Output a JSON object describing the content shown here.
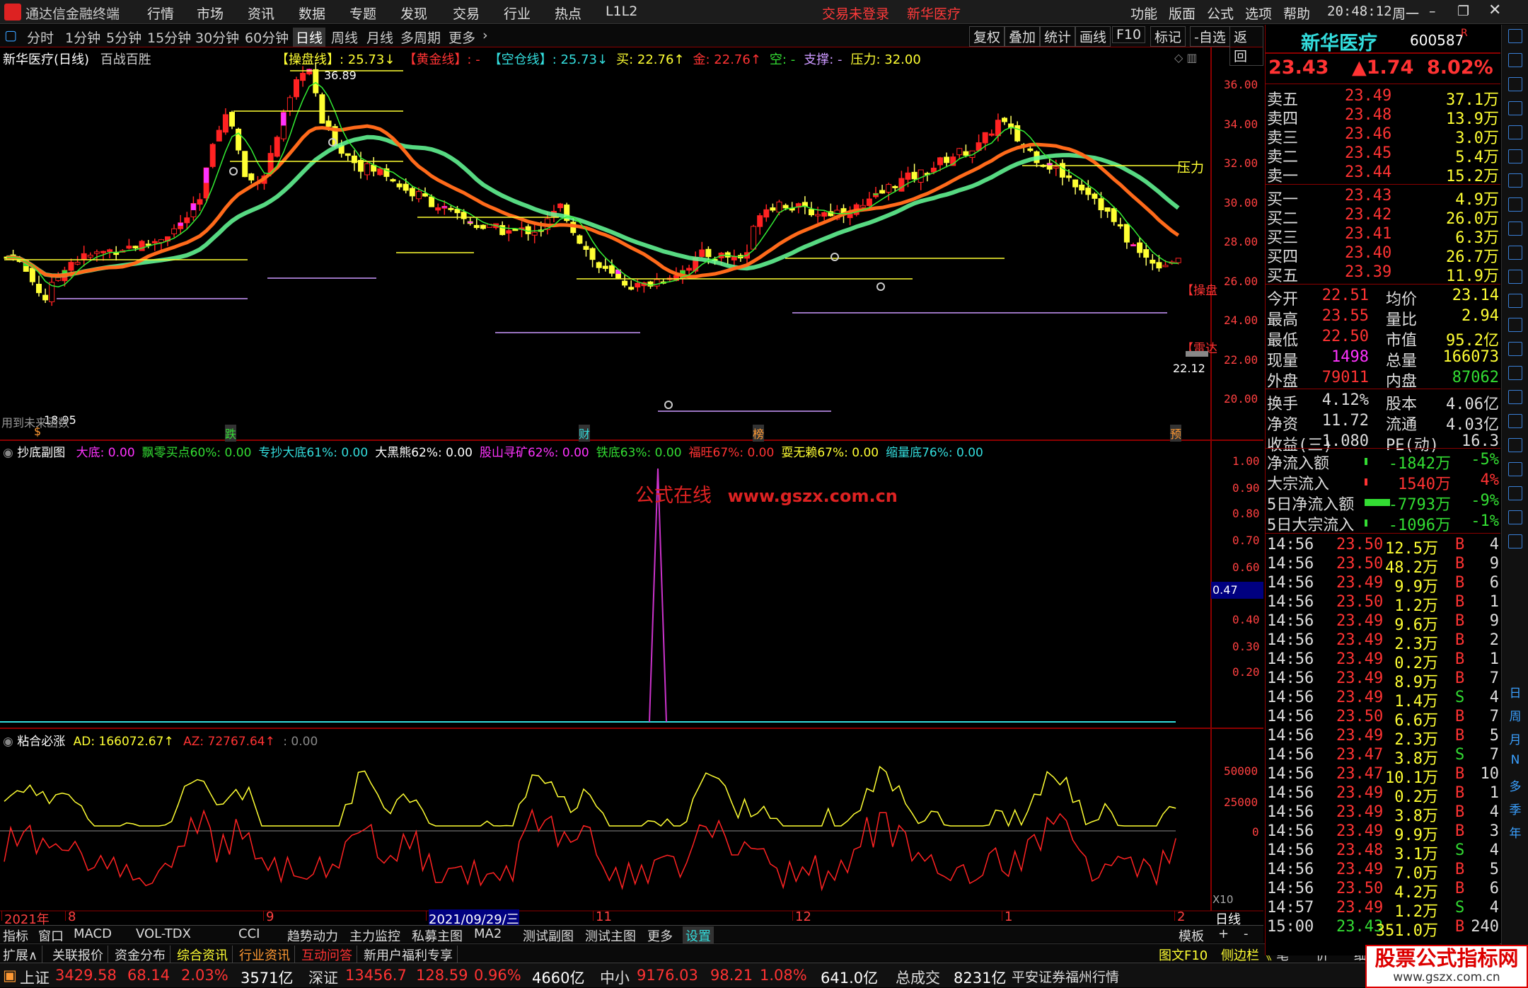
{
  "titlebar": {
    "app": "通达信金融终端",
    "menu": [
      "行情",
      "市场",
      "资讯",
      "数据",
      "专题",
      "发现",
      "交易",
      "行业",
      "热点",
      "L1L2"
    ],
    "login": "交易未登录",
    "stock": "新华医疗",
    "right": [
      "功能",
      "版面",
      "公式",
      "选项",
      "帮助"
    ],
    "time": "20:48:12",
    "weekday": "周一"
  },
  "toolbar": {
    "periods": [
      "分时",
      "1分钟",
      "5分钟",
      "15分钟",
      "30分钟",
      "60分钟",
      "日线",
      "周线",
      "月线",
      "多周期",
      "更多"
    ],
    "active": "日线",
    "buttons": [
      "复权",
      "叠加",
      "统计",
      "画线",
      "F10",
      "标记",
      "-自选",
      "返回"
    ]
  },
  "main_chart": {
    "title": "新华医疗(日线)",
    "subtitle": "百战百胜",
    "indicators": [
      {
        "label": "【操盘线】",
        "value": ": 25.73↓",
        "color": "#ffff33"
      },
      {
        "label": "【黄金线】",
        "value": ": -",
        "color": "#ff3333"
      },
      {
        "label": "【空仓线】",
        "value": ": 25.73↓",
        "color": "#33dddd"
      },
      {
        "label": "买",
        "value": ": 22.76↑",
        "color": "#ffff33"
      },
      {
        "label": "金",
        "value": ": 22.76↑",
        "color": "#ff3333"
      },
      {
        "label": "空",
        "value": ": -",
        "color": "#33dd33"
      },
      {
        "label": "支撑",
        "value": ": -",
        "color": "#cc99ff"
      },
      {
        "label": "压力",
        "value": ": 32.00",
        "color": "#ffff33"
      }
    ],
    "yaxis": [
      "36.00",
      "34.00",
      "32.00",
      "30.00",
      "28.00",
      "26.00",
      "24.00",
      "22.00",
      "20.00"
    ],
    "annotations": {
      "high": "36.89",
      "low": "18.95",
      "last": "22.12",
      "pressure": "压力",
      "op": "【操盘",
      "lei": "【雷达",
      "mid": "用到未来函数"
    },
    "bottom_marks": [
      "$",
      "跌",
      "财",
      "榜",
      "预"
    ]
  },
  "sub1": {
    "title": "抄底副图",
    "items": [
      {
        "t": "大底: 0.00",
        "c": "#ff33ff"
      },
      {
        "t": "飘零买点60%: 0.00",
        "c": "#33dd33"
      },
      {
        "t": "专抄大底61%: 0.00",
        "c": "#33dddd"
      },
      {
        "t": "大黑熊62%: 0.00",
        "c": "#ffffff"
      },
      {
        "t": "股山寻矿62%: 0.00",
        "c": "#ff33ff"
      },
      {
        "t": "铁底63%: 0.00",
        "c": "#33dd33"
      },
      {
        "t": "福旺67%: 0.00",
        "c": "#ff3333"
      },
      {
        "t": "耍无赖67%: 0.00",
        "c": "#ffff33"
      },
      {
        "t": "缩量底76%: 0.00",
        "c": "#33dddd"
      }
    ],
    "watermark": "公式在线",
    "watermark_url": "www.gszx.com.cn",
    "yaxis": [
      "1.00",
      "0.90",
      "0.80",
      "0.70",
      "0.60",
      "0.40",
      "0.30",
      "0.20"
    ],
    "current": "0.47"
  },
  "sub2": {
    "title": "粘合必涨",
    "ad": "AD: 166072.67↑",
    "az": "AZ: 72767.64↑",
    "extra": ": 0.00",
    "yaxis": [
      "50000",
      "25000",
      "0"
    ],
    "x10": "X10"
  },
  "dates": {
    "labels": [
      "2021年",
      "8",
      "9",
      "2021/09/29/三",
      "11",
      "12",
      "1",
      "2"
    ],
    "right": "日线"
  },
  "bottomtabs": [
    "指标",
    "窗口",
    "MACD",
    "VOL-TDX",
    "CCI",
    "趋势动力",
    "主力监控",
    "私募主图",
    "MA2",
    "测试副图",
    "测试主图",
    "更多",
    "设置"
  ],
  "bottomtabs_right": [
    "模板",
    "+",
    "-"
  ],
  "bar2": [
    "扩展∧",
    "关联报价",
    "资金分布",
    "综合资讯",
    "行业资讯",
    "互动问答",
    "新用户福利专享"
  ],
  "bar2_right": [
    "图文F10",
    "侧边栏《",
    "笔",
    "价",
    "细",
    "势",
    "联",
    "值",
    "主"
  ],
  "quote": {
    "name": "新华医疗",
    "code": "600587",
    "r": "R",
    "price": "23.43",
    "change": "▲1.74",
    "pct": "8.02%",
    "asks": [
      [
        "卖五",
        "23.49",
        "37.1万"
      ],
      [
        "卖四",
        "23.48",
        "13.9万"
      ],
      [
        "卖三",
        "23.46",
        "3.0万"
      ],
      [
        "卖二",
        "23.45",
        "5.4万"
      ],
      [
        "卖一",
        "23.44",
        "15.2万"
      ]
    ],
    "bids": [
      [
        "买一",
        "23.43",
        "4.9万"
      ],
      [
        "买二",
        "23.42",
        "26.0万"
      ],
      [
        "买三",
        "23.41",
        "6.3万"
      ],
      [
        "买四",
        "23.40",
        "26.7万"
      ],
      [
        "买五",
        "23.39",
        "11.9万"
      ]
    ],
    "stats": [
      [
        "今开",
        "22.51",
        "均价",
        "23.14"
      ],
      [
        "最高",
        "23.55",
        "量比",
        "2.94"
      ],
      [
        "最低",
        "22.50",
        "市值",
        "95.2亿"
      ],
      [
        "现量",
        "1498",
        "总量",
        "166073"
      ],
      [
        "外盘",
        "79011",
        "内盘",
        "87062"
      ]
    ],
    "stats2": [
      [
        "换手",
        "4.12%",
        "股本",
        "4.06亿"
      ],
      [
        "净资",
        "11.72",
        "流通",
        "4.03亿"
      ],
      [
        "收益(三)",
        "1.080",
        "PE(动)",
        "16.3"
      ]
    ],
    "flows": [
      [
        "净流入额",
        "-1842万",
        "-5%"
      ],
      [
        "大宗流入",
        "1540万",
        "4%"
      ],
      [
        "5日净流入额",
        "-7793万",
        "-9%"
      ],
      [
        "5日大宗流入",
        "-1096万",
        "-1%"
      ]
    ],
    "ticks": [
      [
        "14:56",
        "23.50",
        "12.5万",
        "B",
        "4"
      ],
      [
        "14:56",
        "23.50",
        "48.2万",
        "B",
        "9"
      ],
      [
        "14:56",
        "23.49",
        "9.9万",
        "B",
        "6"
      ],
      [
        "14:56",
        "23.50",
        "1.2万",
        "B",
        "1"
      ],
      [
        "14:56",
        "23.49",
        "9.6万",
        "B",
        "9"
      ],
      [
        "14:56",
        "23.49",
        "2.3万",
        "B",
        "2"
      ],
      [
        "14:56",
        "23.49",
        "0.2万",
        "B",
        "1"
      ],
      [
        "14:56",
        "23.49",
        "8.9万",
        "B",
        "7"
      ],
      [
        "14:56",
        "23.49",
        "1.4万",
        "S",
        "4"
      ],
      [
        "14:56",
        "23.50",
        "6.6万",
        "B",
        "7"
      ],
      [
        "14:56",
        "23.49",
        "2.3万",
        "B",
        "5"
      ],
      [
        "14:56",
        "23.47",
        "3.8万",
        "S",
        "7"
      ],
      [
        "14:56",
        "23.47",
        "10.1万",
        "B",
        "10"
      ],
      [
        "14:56",
        "23.49",
        "0.2万",
        "B",
        "1"
      ],
      [
        "14:56",
        "23.49",
        "3.8万",
        "B",
        "4"
      ],
      [
        "14:56",
        "23.49",
        "9.9万",
        "B",
        "3"
      ],
      [
        "14:56",
        "23.48",
        "3.1万",
        "S",
        "4"
      ],
      [
        "14:56",
        "23.49",
        "7.0万",
        "B",
        "5"
      ],
      [
        "14:56",
        "23.50",
        "4.2万",
        "B",
        "6"
      ],
      [
        "14:57",
        "23.49",
        "1.2万",
        "S",
        "4"
      ],
      [
        "15:00",
        "23.43",
        "351.0万",
        "B",
        "240"
      ]
    ]
  },
  "sidebar_labels": [
    "日",
    "周",
    "月",
    "N",
    "多",
    "季",
    "年"
  ],
  "status": {
    "sh_label": "上证",
    "sh": "3429.58",
    "sh_chg": "68.14",
    "sh_pct": "2.03%",
    "sh_amt": "3571亿",
    "sz_label": "深证",
    "sz": "13456.7",
    "sz_chg": "128.59",
    "sz_pct": "0.96%",
    "sz_amt": "4660亿",
    "zx_label": "中小",
    "zx": "9176.03",
    "zx_chg": "98.21",
    "zx_pct": "1.08%",
    "zx_amt": "641.0亿",
    "total_label": "总成交",
    "total": "8231亿",
    "broker": "平安证券福州行情",
    "logo": "股票公式指标网",
    "logo_url": "www.gszx.com.cn"
  },
  "colors": {
    "up": "#ff3333",
    "down": "#33dddd",
    "ma_green": "#66ff99",
    "ma_orange": "#ff6a1a",
    "yellow": "#ffff33"
  }
}
